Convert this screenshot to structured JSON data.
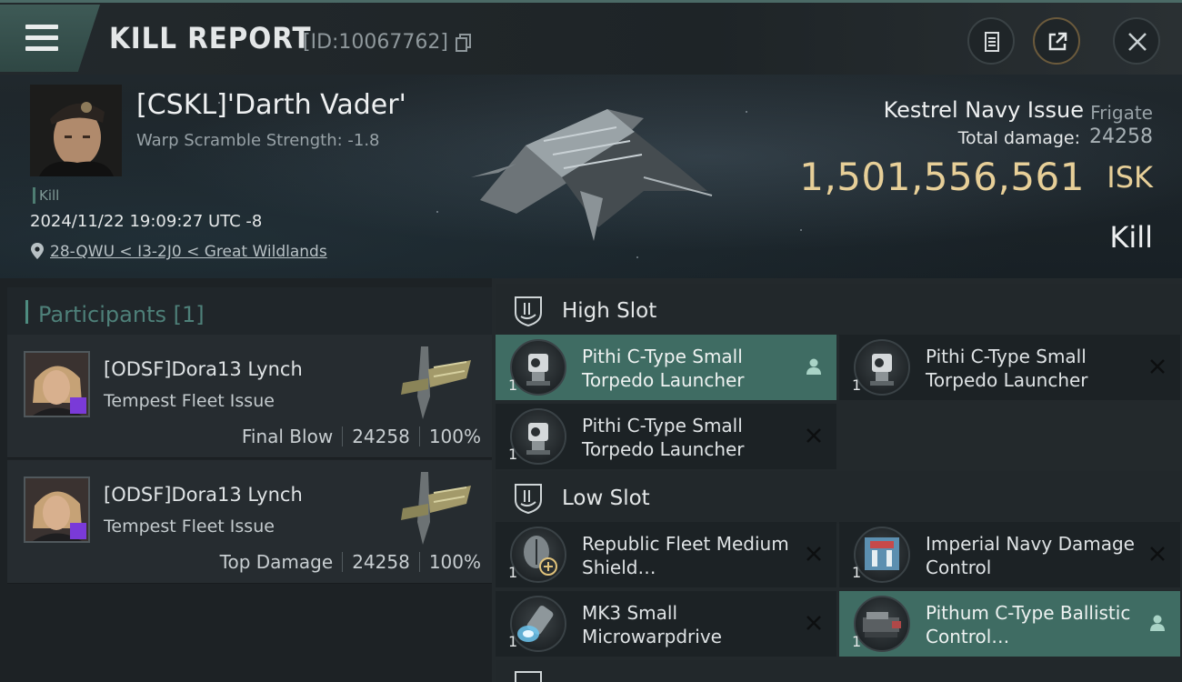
{
  "header": {
    "title": "KILL REPORT",
    "report_id": "[ID:10067762]"
  },
  "victim": {
    "name": "[CSKL]'Darth Vader'",
    "warp_scramble": "Warp Scramble Strength: -1.8",
    "tag": "Kill",
    "datetime": "2024/11/22 19:09:27 UTC -8",
    "location": "28-QWU < I3-2J0 < Great Wildlands",
    "ship_name": "Kestrel Navy Issue",
    "ship_class": "Frigate",
    "total_damage_label": "Total damage:",
    "total_damage": "24258",
    "isk_value": "1,501,556,561",
    "isk_unit": "ISK",
    "result": "Kill"
  },
  "participants": {
    "title": "Participants",
    "count": "[1]",
    "items": [
      {
        "name": "[ODSF]Dora13 Lynch",
        "ship": "Tempest Fleet Issue",
        "role": "Final Blow",
        "damage": "24258",
        "percent": "100%"
      },
      {
        "name": "[ODSF]Dora13 Lynch",
        "ship": "Tempest Fleet Issue",
        "role": "Top Damage",
        "damage": "24258",
        "percent": "100%"
      }
    ]
  },
  "slots": {
    "high": {
      "title": "High Slot",
      "modules": [
        {
          "name": "Pithi C-Type Small Torpedo Launcher",
          "qty": "1",
          "status": "person-icon"
        },
        {
          "name": "Pithi C-Type Small Torpedo Launcher",
          "qty": "1",
          "status": "destroyed-icon"
        },
        {
          "name": "Pithi C-Type Small Torpedo Launcher",
          "qty": "1",
          "status": "destroyed-icon"
        }
      ]
    },
    "low": {
      "title": "Low Slot",
      "modules": [
        {
          "name": "Republic Fleet Medium Shield…",
          "qty": "1",
          "status": "destroyed-icon"
        },
        {
          "name": "Imperial Navy Damage Control",
          "qty": "1",
          "status": "destroyed-icon"
        },
        {
          "name": "MK3 Small Microwarpdrive",
          "qty": "1",
          "status": "destroyed-icon"
        },
        {
          "name": "Pithum C-Type Ballistic Control…",
          "qty": "1",
          "status": "person-icon"
        }
      ]
    }
  },
  "colors": {
    "accent_teal": "#3f6c63",
    "isk_gold": "#e7cf98",
    "header_tab": "#3e5a56"
  }
}
